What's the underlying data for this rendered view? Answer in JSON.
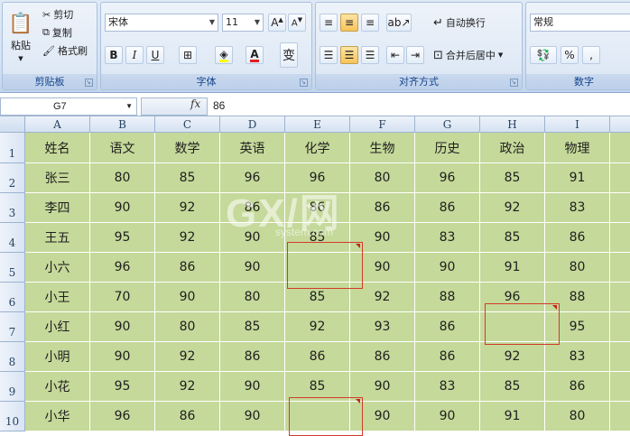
{
  "ribbon": {
    "clipboard": {
      "label": "剪贴板",
      "paste": "粘贴",
      "cut": "剪切",
      "copy": "复制",
      "format_painter": "格式刷"
    },
    "font": {
      "label": "字体",
      "font_name": "宋体",
      "font_size": "11",
      "bold": "B",
      "italic": "I",
      "underline": "U"
    },
    "alignment": {
      "label": "对齐方式",
      "wrap_text": "自动换行",
      "merge_center": "合并后居中"
    },
    "number": {
      "label": "数字",
      "format": "常规",
      "percent": "%"
    }
  },
  "formula_bar": {
    "name_box": "G7",
    "fx": "fx",
    "value": "86"
  },
  "sheet": {
    "columns": [
      "A",
      "B",
      "C",
      "D",
      "E",
      "F",
      "G",
      "H",
      "I"
    ],
    "row_numbers": [
      "1",
      "2",
      "3",
      "4",
      "5",
      "6",
      "7",
      "8",
      "9",
      "10"
    ],
    "rows": [
      [
        "姓名",
        "语文",
        "数学",
        "英语",
        "化学",
        "生物",
        "历史",
        "政治",
        "物理"
      ],
      [
        "张三",
        "80",
        "85",
        "96",
        "96",
        "80",
        "96",
        "85",
        "91"
      ],
      [
        "李四",
        "90",
        "92",
        "86",
        "86",
        "86",
        "86",
        "92",
        "83"
      ],
      [
        "王五",
        "95",
        "92",
        "90",
        "85",
        "90",
        "83",
        "85",
        "86"
      ],
      [
        "小六",
        "96",
        "86",
        "90",
        "",
        "90",
        "90",
        "91",
        "80"
      ],
      [
        "小王",
        "70",
        "90",
        "80",
        "85",
        "92",
        "88",
        "96",
        "88"
      ],
      [
        "小红",
        "90",
        "80",
        "85",
        "92",
        "93",
        "86",
        "",
        "95"
      ],
      [
        "小明",
        "90",
        "92",
        "86",
        "86",
        "86",
        "86",
        "92",
        "83"
      ],
      [
        "小花",
        "95",
        "92",
        "90",
        "85",
        "90",
        "83",
        "85",
        "86"
      ],
      [
        "小华",
        "96",
        "86",
        "90",
        "",
        "90",
        "90",
        "91",
        "80"
      ]
    ]
  },
  "watermark": {
    "main": "GX/网",
    "sub": "system.com"
  },
  "colors": {
    "cell_fill": "#c5d99a",
    "highlight_border": "#d23b2a"
  }
}
